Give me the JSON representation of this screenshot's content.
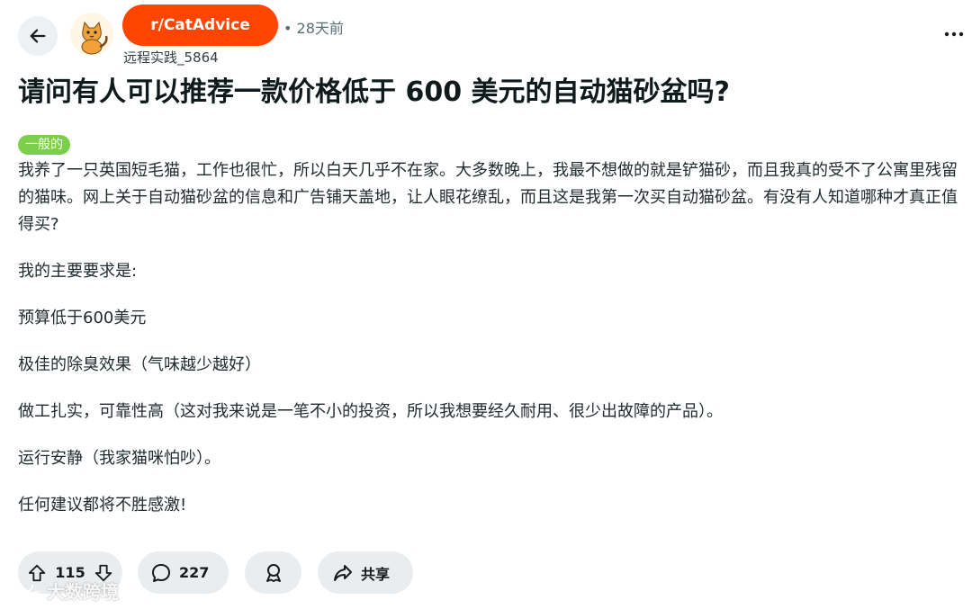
{
  "header": {
    "subreddit": "r/CatAdvice",
    "time_ago": "• 28天前",
    "username": "远程实践_5864",
    "avatar_icon": "cat-avatar-icon",
    "avatar_text": "r/catadvice",
    "back_icon": "arrow-left-icon",
    "more_icon": "more-horizontal-icon",
    "subreddit_color": "#ff4500"
  },
  "post": {
    "title": "请问有人可以推荐一款价格低于 600 美元的自动猫砂盆吗?",
    "flair": "一般的",
    "flair_color": "#7ccf4a",
    "paragraphs": [
      "我养了一只英国短毛猫，工作也很忙，所以白天几乎不在家。大多数晚上，我最不想做的就是铲猫砂，而且我真的受不了公寓里残留的猫味。网上关于自动猫砂盆的信息和广告铺天盖地，让人眼花缭乱，而且这是我第一次买自动猫砂盆。有没有人知道哪种才真正值得买?",
      "我的主要要求是:",
      "预算低于600美元",
      "极佳的除臭效果（气味越少越好）",
      "做工扎实，可靠性高（这对我来说是一笔不小的投资，所以我想要经久耐用、很少出故障的产品）。",
      "运行安静（我家猫咪怕吵）。",
      "任何建议都将不胜感激!"
    ]
  },
  "actions": {
    "upvotes": "115",
    "comments": "227",
    "share_label": "共享",
    "upvote_icon": "upvote-arrow-icon",
    "downvote_icon": "downvote-arrow-icon",
    "comment_icon": "comment-bubble-icon",
    "award_icon": "award-icon",
    "share_icon": "share-arrow-icon"
  },
  "watermark": {
    "text": "大数跨境",
    "icon": "watermark-logo-icon"
  }
}
